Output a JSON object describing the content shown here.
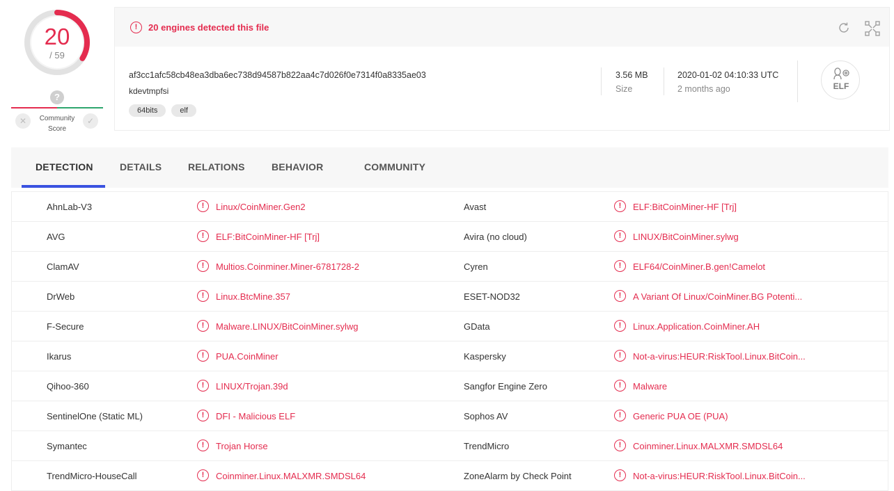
{
  "score": {
    "detected": "20",
    "total": "/ 59",
    "detection_fraction": 0.339,
    "community_question": "?",
    "community_label_line1": "Community",
    "community_label_line2": "Score"
  },
  "summary": {
    "detect_message": "20 engines detected this file",
    "hash": "af3cc1afc58cb48ea3dba6ec738d94587b822aa4c7d026f0e7314f0a8335ae03",
    "filename": "kdevtmpfsi",
    "tags": [
      "64bits",
      "elf"
    ],
    "size_value": "3.56 MB",
    "size_label": "Size",
    "date_value": "2020-01-02 04:10:33 UTC",
    "date_relative": "2 months ago",
    "file_type": "ELF"
  },
  "tabs": [
    {
      "label": "DETECTION",
      "active": true
    },
    {
      "label": "DETAILS",
      "active": false
    },
    {
      "label": "RELATIONS",
      "active": false
    },
    {
      "label": "BEHAVIOR",
      "active": false
    },
    {
      "label": "COMMUNITY",
      "active": false
    }
  ],
  "detections": [
    {
      "engine_left": "AhnLab-V3",
      "result_left": "Linux/CoinMiner.Gen2",
      "engine_right": "Avast",
      "result_right": "ELF:BitCoinMiner-HF [Trj]"
    },
    {
      "engine_left": "AVG",
      "result_left": "ELF:BitCoinMiner-HF [Trj]",
      "engine_right": "Avira (no cloud)",
      "result_right": "LINUX/BitCoinMiner.sylwg"
    },
    {
      "engine_left": "ClamAV",
      "result_left": "Multios.Coinminer.Miner-6781728-2",
      "engine_right": "Cyren",
      "result_right": "ELF64/CoinMiner.B.gen!Camelot"
    },
    {
      "engine_left": "DrWeb",
      "result_left": "Linux.BtcMine.357",
      "engine_right": "ESET-NOD32",
      "result_right": "A Variant Of Linux/CoinMiner.BG Potenti..."
    },
    {
      "engine_left": "F-Secure",
      "result_left": "Malware.LINUX/BitCoinMiner.sylwg",
      "engine_right": "GData",
      "result_right": "Linux.Application.CoinMiner.AH"
    },
    {
      "engine_left": "Ikarus",
      "result_left": "PUA.CoinMiner",
      "engine_right": "Kaspersky",
      "result_right": "Not-a-virus:HEUR:RiskTool.Linux.BitCoin..."
    },
    {
      "engine_left": "Qihoo-360",
      "result_left": "LINUX/Trojan.39d",
      "engine_right": "Sangfor Engine Zero",
      "result_right": "Malware"
    },
    {
      "engine_left": "SentinelOne (Static ML)",
      "result_left": "DFI - Malicious ELF",
      "engine_right": "Sophos AV",
      "result_right": "Generic PUA OE (PUA)"
    },
    {
      "engine_left": "Symantec",
      "result_left": "Trojan Horse",
      "engine_right": "TrendMicro",
      "result_right": "Coinminer.Linux.MALXMR.SMDSL64"
    },
    {
      "engine_left": "TrendMicro-HouseCall",
      "result_left": "Coinminer.Linux.MALXMR.SMDSL64",
      "engine_right": "ZoneAlarm by Check Point",
      "result_right": "Not-a-virus:HEUR:RiskTool.Linux.BitCoin..."
    }
  ],
  "icons": {
    "alert": "!",
    "reload": "reload-icon",
    "expand": "expand-icon",
    "close": "✕",
    "check": "✓"
  },
  "colors": {
    "alert_red": "#e42c4f",
    "accent_blue": "#3a52e0",
    "positive_green": "#2ea66e"
  }
}
